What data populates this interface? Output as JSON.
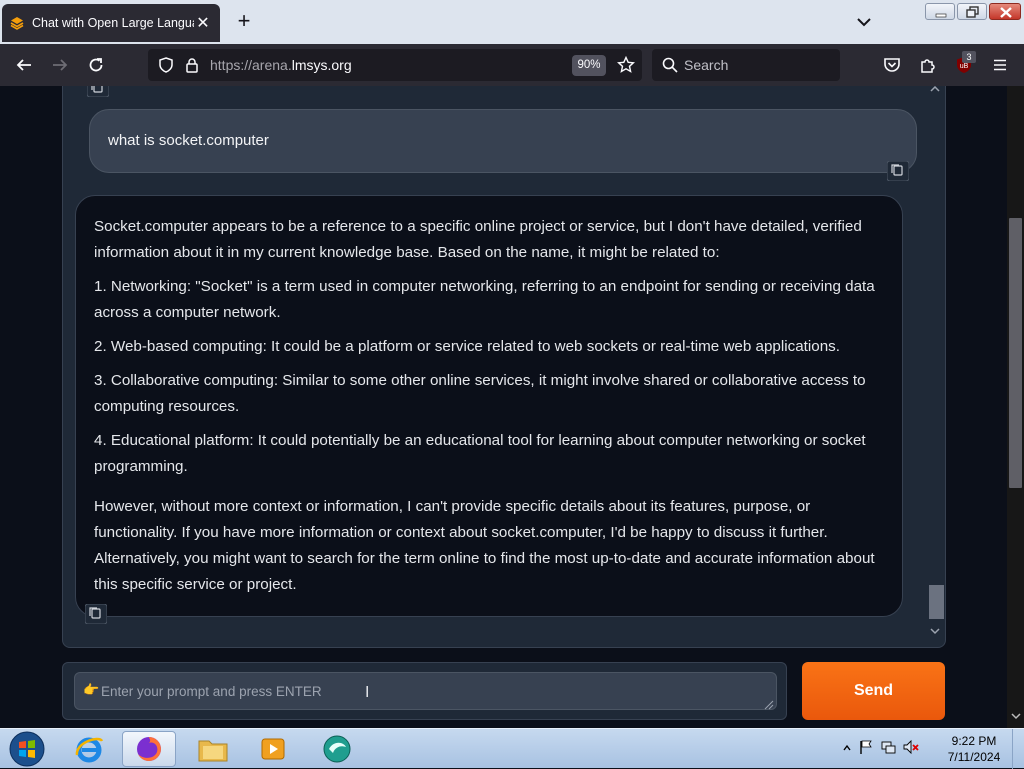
{
  "browser": {
    "tab_title": "Chat with Open Large Languag",
    "url_prefix": "https://arena.",
    "url_domain": "lmsys.org",
    "zoom": "90%",
    "search_placeholder": "Search",
    "extension_badge": "3"
  },
  "chat": {
    "user_message": "what is socket.computer",
    "bot_paragraphs": [
      "Socket.computer appears to be a reference to a specific online project or service, but I don't have detailed, verified information about it in my current knowledge base. Based on the name, it might be related to:",
      "1. Networking: \"Socket\" is a term used in computer networking, referring to an endpoint for sending or receiving data across a computer network.",
      "2. Web-based computing: It could be a platform or service related to web sockets or real-time web applications.",
      "3. Collaborative computing: Similar to some other online services, it might involve shared or collaborative access to computing resources.",
      "4. Educational platform: It could potentially be an educational tool for learning about computer networking or socket programming.",
      "However, without more context or information, I can't provide specific details about its features, purpose, or functionality. If you have more information or context about socket.computer, I'd be happy to discuss it further. Alternatively, you might want to search for the term online to find the most up-to-date and accurate information about this specific service or project."
    ]
  },
  "input": {
    "placeholder": "Enter your prompt and press ENTER",
    "emoji": "👉",
    "send_label": "Send"
  },
  "taskbar": {
    "time": "9:22 PM",
    "date": "7/11/2024"
  },
  "colors": {
    "accent": "#f97316",
    "page_bg": "#0b0f19",
    "panel_bg": "#1f2937"
  }
}
